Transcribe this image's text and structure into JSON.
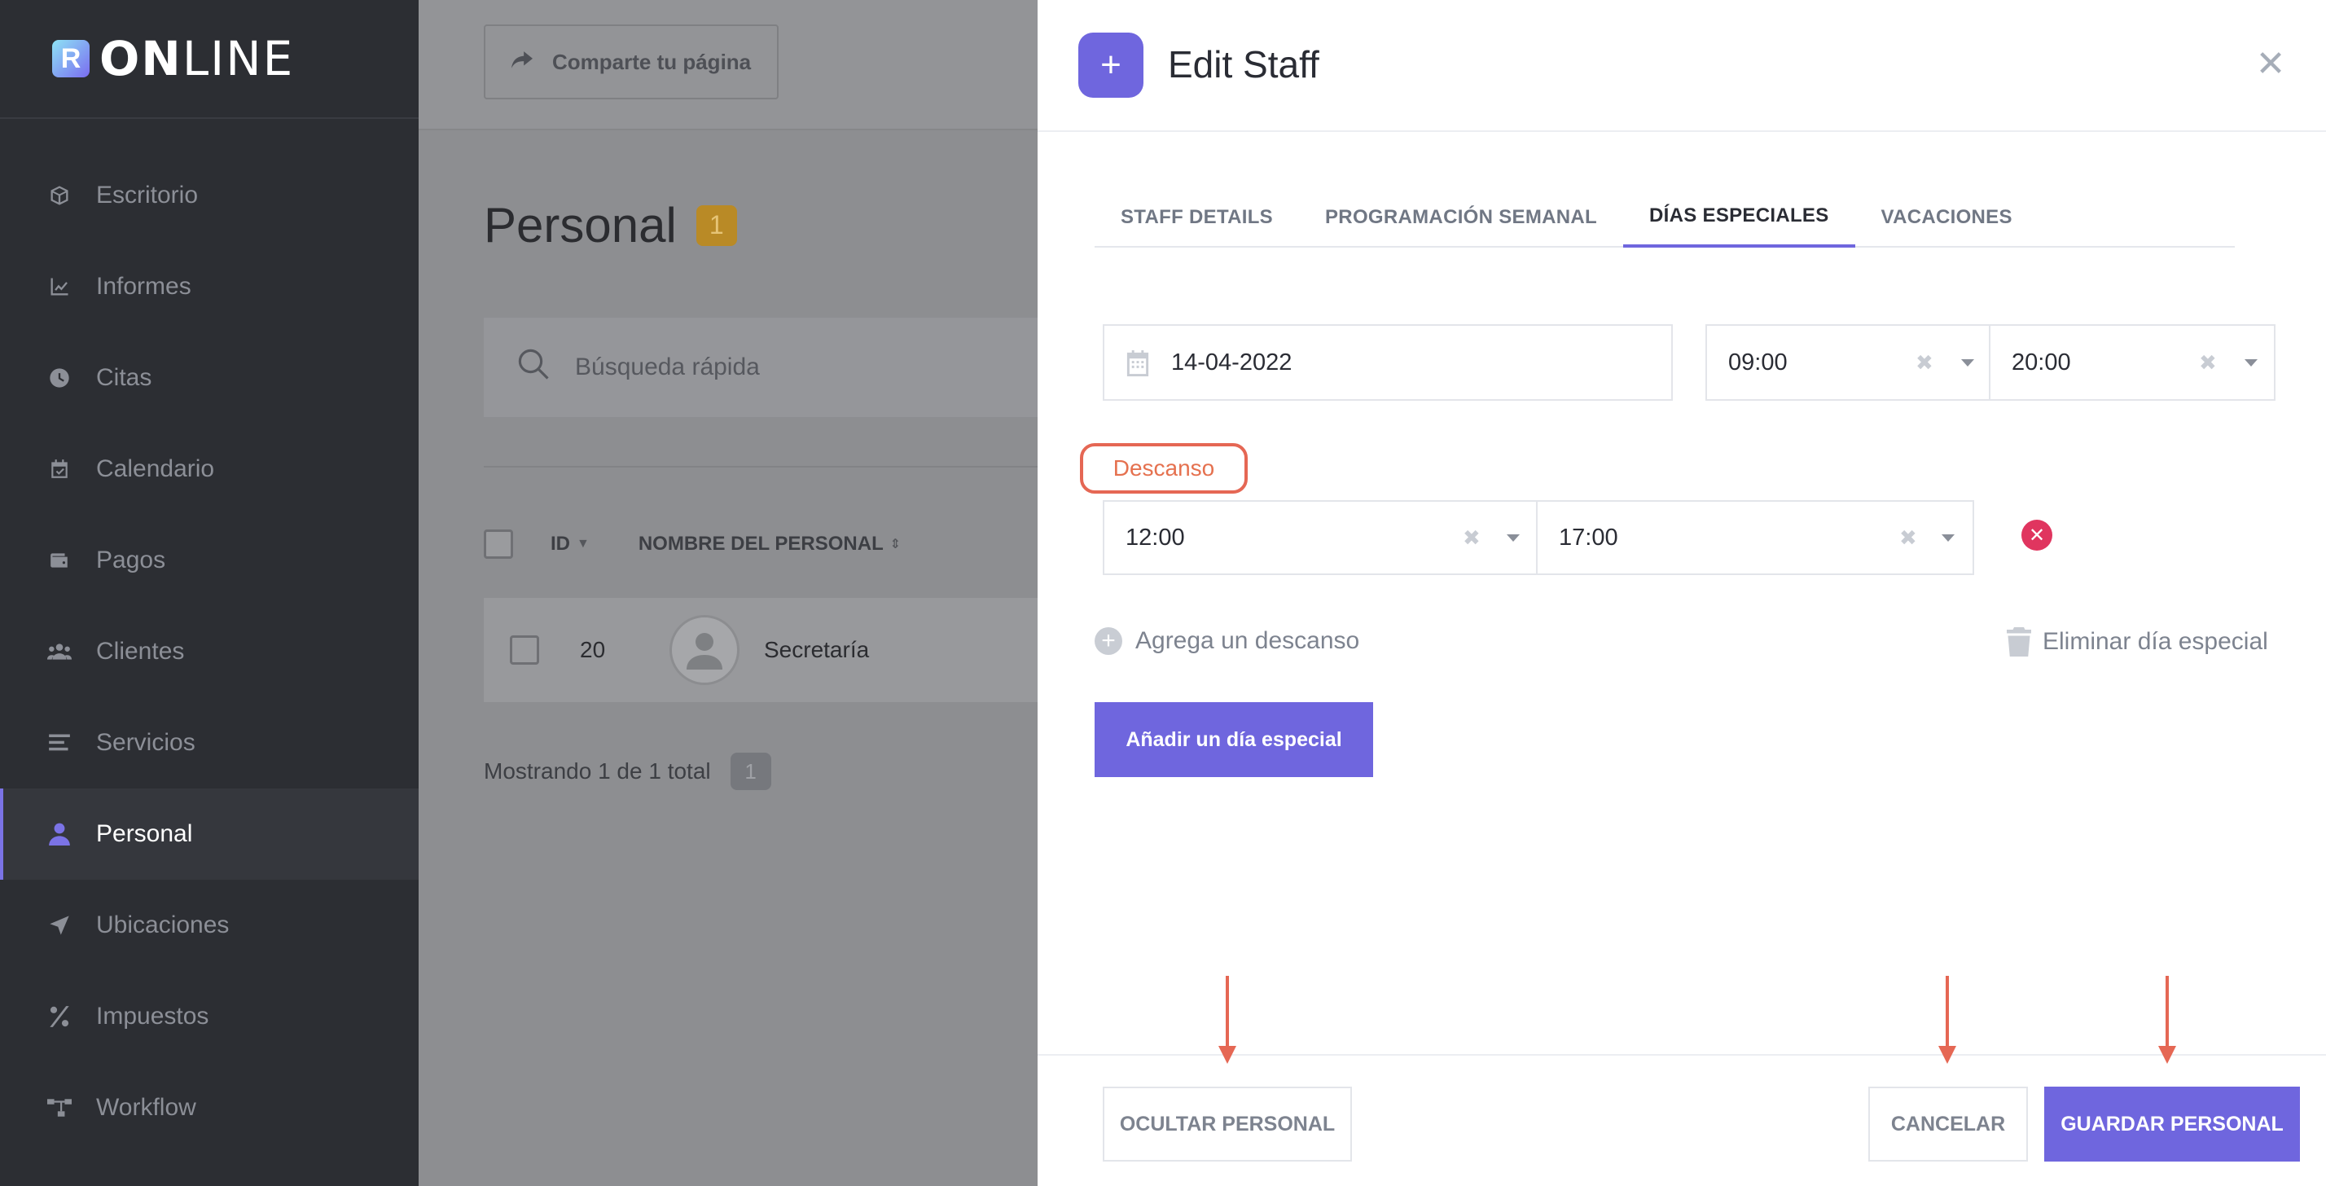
{
  "sidebar": {
    "logo": {
      "mark": "R",
      "bold": "ON",
      "light": "LINE"
    },
    "items": [
      {
        "label": "Escritorio",
        "icon": "cube-icon"
      },
      {
        "label": "Informes",
        "icon": "chart-line-icon"
      },
      {
        "label": "Citas",
        "icon": "clock-icon"
      },
      {
        "label": "Calendario",
        "icon": "calendar-check-icon"
      },
      {
        "label": "Pagos",
        "icon": "wallet-icon"
      },
      {
        "label": "Clientes",
        "icon": "users-icon"
      },
      {
        "label": "Servicios",
        "icon": "list-icon"
      },
      {
        "label": "Personal",
        "icon": "user-icon",
        "active": true
      },
      {
        "label": "Ubicaciones",
        "icon": "location-arrow-icon"
      },
      {
        "label": "Impuestos",
        "icon": "percent-icon"
      },
      {
        "label": "Workflow",
        "icon": "workflow-icon"
      }
    ]
  },
  "main": {
    "share_label": "Comparte tu página",
    "title": "Personal",
    "title_count": "1",
    "search_placeholder": "Búsqueda rápida",
    "table": {
      "col_id": "ID",
      "col_name": "NOMBRE DEL PERSONAL",
      "rows": [
        {
          "id": "20",
          "name": "Secretaría"
        }
      ]
    },
    "footer_text": "Mostrando 1 de 1 total",
    "footer_count": "1"
  },
  "modal": {
    "title": "Edit Staff",
    "tabs": [
      "STAFF DETAILS",
      "PROGRAMACIÓN SEMANAL",
      "DÍAS ESPECIALES",
      "VACACIONES"
    ],
    "active_tab": "DÍAS ESPECIALES",
    "special_day": {
      "date": "14-04-2022",
      "start": "09:00",
      "end": "20:00",
      "break_label": "Descanso",
      "break_start": "12:00",
      "break_end": "17:00"
    },
    "add_break_label": "Agrega un descanso",
    "delete_day_label": "Eliminar día especial",
    "add_day_label": "Añadir un día especial",
    "footer": {
      "hide_label": "OCULTAR PERSONAL",
      "cancel_label": "CANCELAR",
      "save_label": "GUARDAR PERSONAL"
    }
  },
  "colors": {
    "accent": "#6f66de",
    "annotation": "#e56754",
    "danger": "#e0355f",
    "sidebar_bg": "#2c2e33"
  }
}
